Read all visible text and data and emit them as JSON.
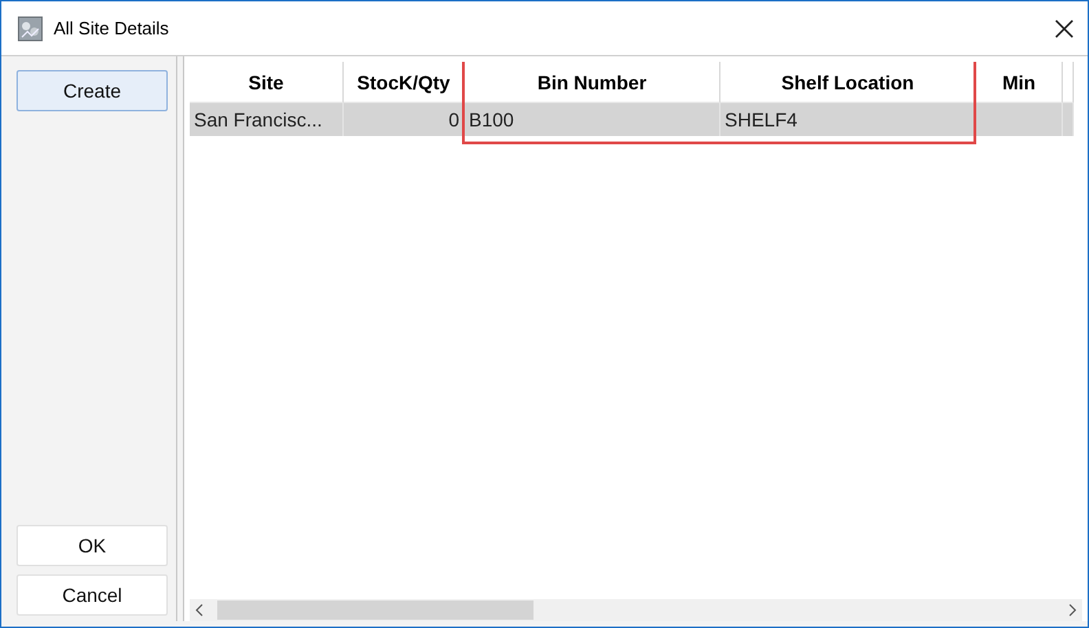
{
  "window": {
    "title": "All Site Details"
  },
  "side_buttons": [
    {
      "label": "Create",
      "selected": true
    },
    {
      "label": "OK",
      "selected": false
    },
    {
      "label": "Cancel",
      "selected": false
    }
  ],
  "table": {
    "columns": [
      {
        "label": "Site",
        "highlighted": false
      },
      {
        "label": "StocK/Qty",
        "highlighted": false
      },
      {
        "label": "Bin Number",
        "highlighted": true
      },
      {
        "label": "Shelf Location",
        "highlighted": true
      },
      {
        "label": "Min",
        "highlighted": false
      }
    ],
    "rows": [
      {
        "selected": true,
        "cells": [
          "San Francisc...",
          "0",
          "B100",
          "SHELF4",
          ""
        ]
      }
    ]
  }
}
